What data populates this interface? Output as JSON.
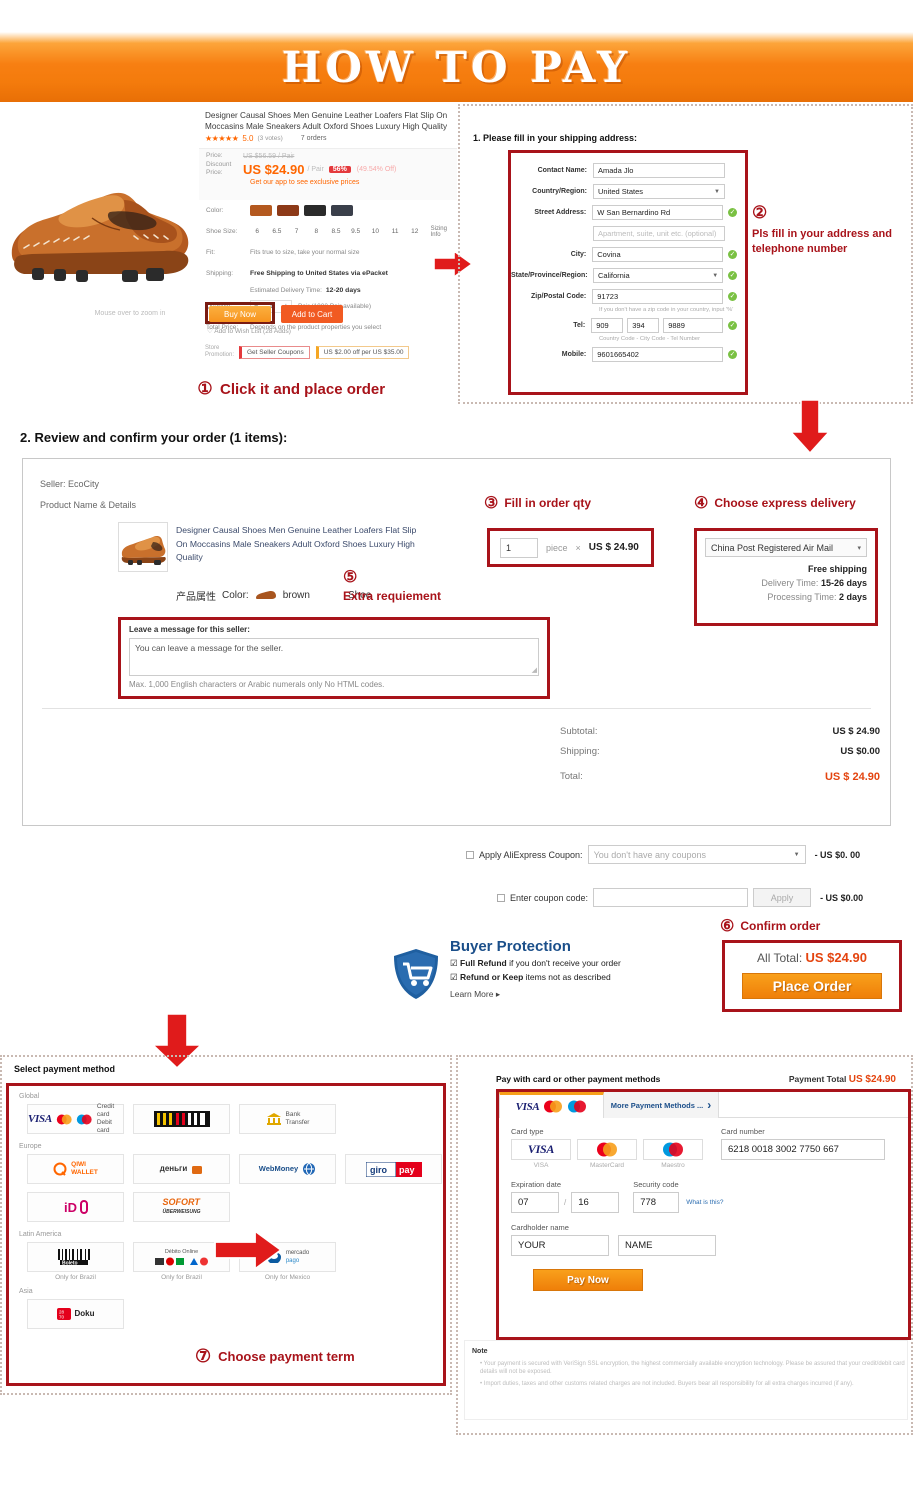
{
  "banner": {
    "title": "HOW TO PAY"
  },
  "product": {
    "title": "Designer Causal Shoes Men Genuine Leather Loafers Flat Slip On Moccasins Male Sneakers Adult Oxford Shoes Luxury High Quality",
    "stars": "★★★★★",
    "rating": "5.0",
    "rating_sub": "(3 votes)",
    "orders": "7 orders",
    "zoom_hint": "Mouse over to zoom in",
    "price_label": "Price:",
    "price_old": "US $56.59 / Pair",
    "discount_label": "Discount Price:",
    "price_now": "US $24.90",
    "price_unit": "/ Pair",
    "discount_badge": "56%",
    "save_text": "(49.54% Off)",
    "app_line": "Get our app to see exclusive prices",
    "color_label": "Color:",
    "size_label": "Shoe Size:",
    "sizes": [
      "6",
      "6.5",
      "7",
      "8",
      "8.5",
      "9.5",
      "10",
      "11",
      "12"
    ],
    "sizing_info": "Sizing Info",
    "fit_label": "Fit:",
    "fit_value": "Fits true to size, take your normal size",
    "shipping_label": "Shipping:",
    "shipping_value": "Free Shipping to United States via ePacket",
    "delivery_label": "Estimated Delivery Time:",
    "delivery_value": "12-20 days",
    "qty_label": "Quantity:",
    "qty_value": "1",
    "qty_stock": "Pair (1000 Pair available)",
    "total_price_label": "Total Price:",
    "total_price_value": "Depends on the product properties you select",
    "buy_now": "Buy Now",
    "add_to_cart": "Add to Cart",
    "wishlist": "Add to Wish List (28 Adds)",
    "store_promo_label": "Store Promotion:",
    "promo1": "Get Seller Coupons",
    "promo2": "US $2.00 off per US $35.00"
  },
  "steps": {
    "s1": {
      "num": "①",
      "text": "Click it and place order"
    },
    "s2": {
      "num": "②",
      "text": "Pls fill in your address and telephone number"
    },
    "s3": {
      "num": "③",
      "text": "Fill in order qty"
    },
    "s4": {
      "num": "④",
      "text": "Choose express delivery"
    },
    "s5": {
      "num": "⑤",
      "text": "Extra requiement"
    },
    "s6": {
      "num": "⑥",
      "text": "Confirm order"
    },
    "s7": {
      "num": "⑦",
      "text": "Choose payment term"
    }
  },
  "address": {
    "heading": "1. Please fill in your shipping address:",
    "fields": [
      {
        "label": "Contact Name:",
        "value": "Amada  Jlo"
      },
      {
        "label": "Country/Region:",
        "value": "United States"
      },
      {
        "label": "Street Address:",
        "value": "W San Bernardino Rd"
      },
      {
        "label": "",
        "value": "Apartment, suite, unit etc. (optional)"
      },
      {
        "label": "City:",
        "value": "Covina"
      },
      {
        "label": "State/Province/Region:",
        "value": "California"
      },
      {
        "label": "Zip/Postal Code:",
        "value": "91723"
      },
      {
        "label": "Mobile:",
        "value": "9601665402"
      }
    ],
    "zip_hint": "If you don't have a zip code in your country, input '%'",
    "tel_label": "Tel:",
    "tel_country": "909",
    "tel_city": "394",
    "tel_number": "9889",
    "tel_hint": "Country Code - City Code - Tel Number"
  },
  "order": {
    "heading": "2. Review and confirm your order (1 items):",
    "seller": "Seller: EcoCity",
    "product_name_details": "Product Name & Details",
    "product_desc": "Designer Causal Shoes Men Genuine Leather Loafers Flat Slip On Moccasins Male Sneakers Adult Oxford Shoes Luxury High Quality",
    "attr_label": "产品属性",
    "attr_color_label": "Color:",
    "attr_color_value": "brown",
    "attr_shoe": "Shoe",
    "qty_value": "1",
    "qty_unit": "piece",
    "qty_times": "×",
    "qty_unit_price": "US $ 24.90",
    "shipping_method": "China Post Registered Air Mail",
    "free_shipping": "Free shipping",
    "delivery_time_label": "Delivery Time:",
    "delivery_time_value": "15-26 days",
    "processing_time_label": "Processing Time:",
    "processing_time_value": "2 days",
    "message_title": "Leave a message for this seller:",
    "message_placeholder": "You can leave a message for the seller.",
    "message_note": "Max. 1,000 English characters or Arabic numerals only  No HTML codes.",
    "subtotal_label": "Subtotal:",
    "subtotal_value": "US $ 24.90",
    "shipping_label": "Shipping:",
    "shipping_value": "US $0.00",
    "total_label": "Total:",
    "total_value": "US $ 24.90"
  },
  "coupons": {
    "apply_label": "Apply AliExpress Coupon:",
    "apply_select": "You don't have any coupons",
    "apply_amount": "- US $0. 00",
    "code_label": "Enter coupon code:",
    "code_value": "",
    "apply_button": "Apply",
    "code_amount": "- US $0.00"
  },
  "buyer_protection": {
    "title": "Buyer Protection",
    "item1_strong": "Full Refund",
    "item1_rest": " if you don't receive your order",
    "item2_strong": "Refund or Keep",
    "item2_rest": " items not as described",
    "learn_more": "Learn More ▸"
  },
  "confirm": {
    "all_total_label": "All Total:",
    "all_total_value": "US $24.90",
    "place_order": "Place Order"
  },
  "payment_methods": {
    "title": "Select payment method",
    "regions": [
      {
        "name": "Global",
        "tiles": [
          {
            "id": "visa-mastercard-maestro",
            "text": "Credit card\nDebit card",
            "caption": ""
          },
          {
            "id": "china-unionpay",
            "text": "UNIONPAY",
            "caption": ""
          },
          {
            "id": "bank-transfer",
            "text": "Bank\nTransfer",
            "caption": ""
          }
        ]
      },
      {
        "name": "Europe",
        "tiles": [
          {
            "id": "qiwi-wallet",
            "text": "QIWI\nWALLET",
            "caption": ""
          },
          {
            "id": "yandex-dengi",
            "text": "деньги",
            "caption": ""
          },
          {
            "id": "webmoney",
            "text": "WebMoney",
            "caption": ""
          },
          {
            "id": "giropay",
            "text": "giropay",
            "caption": ""
          },
          {
            "id": "ideal",
            "text": "iD",
            "caption": ""
          },
          {
            "id": "sofort",
            "text": "SOFORT\nÜBERWEISUNG",
            "caption": ""
          }
        ]
      },
      {
        "name": "Latin America",
        "tiles": [
          {
            "id": "boleto",
            "text": "Boleto",
            "caption": "Only for Brazil"
          },
          {
            "id": "debito-online",
            "text": "Débito Online",
            "caption": "Only for Brazil"
          },
          {
            "id": "mercado-pago",
            "text": "mercado pago",
            "caption": "Only for Mexico"
          }
        ]
      },
      {
        "name": "Asia",
        "tiles": [
          {
            "id": "doku",
            "text": "Doku",
            "caption": ""
          }
        ]
      }
    ]
  },
  "card": {
    "heading": "Pay with card or other payment methods",
    "payment_total_label": "Payment Total",
    "payment_total_value": "US $24.90",
    "tab_cards": "VISA MasterCard Maestro",
    "tab_more": "More Payment Methods ...",
    "card_type_label": "Card type",
    "card_types": [
      {
        "name": "VISA"
      },
      {
        "name": "MasterCard"
      },
      {
        "name": "Maestro"
      }
    ],
    "card_number_label": "Card number",
    "card_number_value": "6218 0018 3002 7750 667",
    "expiration_label": "Expiration date",
    "exp_month": "07",
    "exp_sep": "/",
    "exp_year": "16",
    "security_label": "Security code",
    "security_value": "778",
    "what_is_this": "What is this?",
    "cardholder_label": "Cardholder name",
    "cardholder_first": "YOUR",
    "cardholder_last": "NAME",
    "pay_now": "Pay Now",
    "note_title": "Note",
    "notes": [
      "Your payment is secured with VeriSign SSL encryption, the highest commercially available encryption technology. Please be assured that your credit/debit card details will not be exposed.",
      "Import duties, taxes and other customs related charges are not included. Buyers bear all responsibility for all extra charges incurred (if any)."
    ]
  },
  "colors": {
    "accent_orange": "#f47b0c",
    "step_red": "#a8131a",
    "price_red": "#e4440f",
    "visa_blue": "#1a1f71"
  }
}
